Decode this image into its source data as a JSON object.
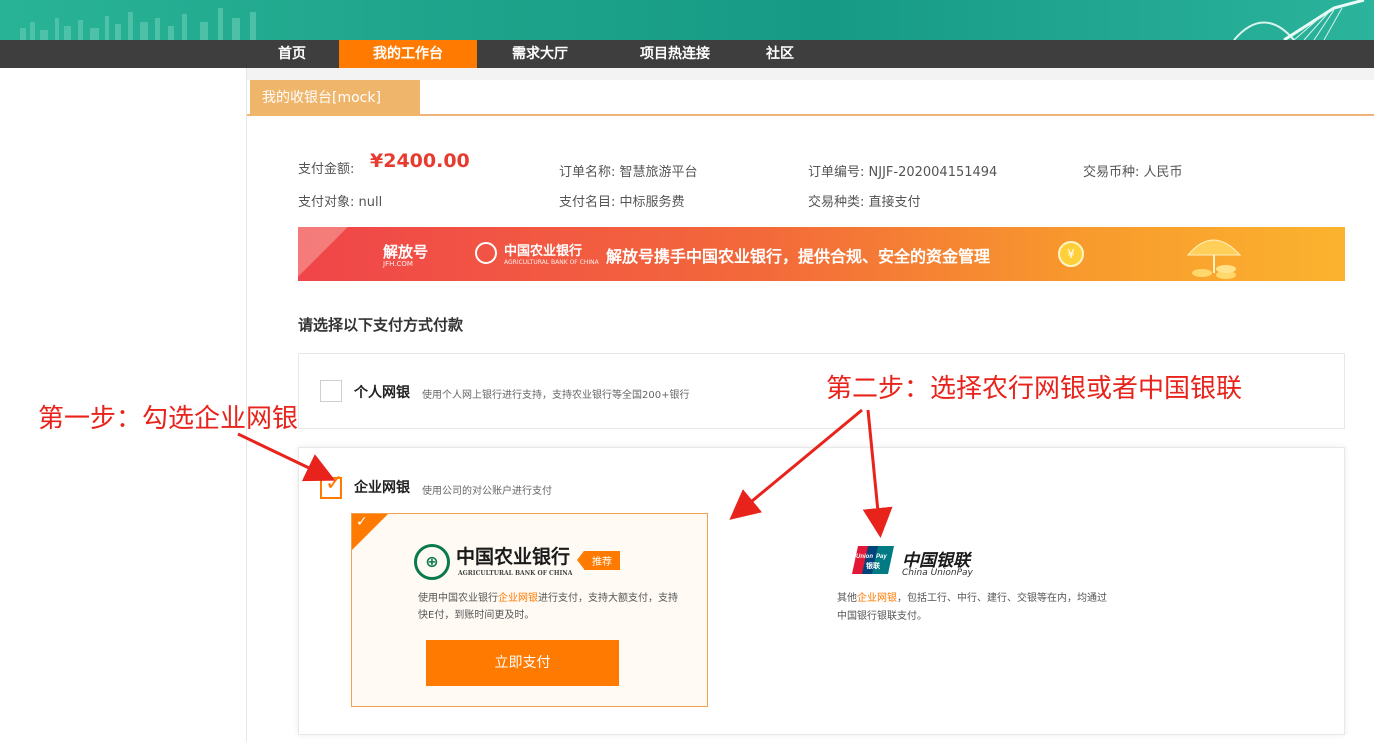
{
  "nav": {
    "items": [
      "首页",
      "我的工作台",
      "需求大厅",
      "项目热连接",
      "社区"
    ],
    "active_index": 1
  },
  "tab": {
    "label": "我的收银台[mock]"
  },
  "order": {
    "amount_label": "支付金额:",
    "amount_value": "¥2400.00",
    "order_name": "订单名称: 智慧旅游平台",
    "order_no": "订单编号: NJJF-202004151494",
    "currency": "交易币种: 人民币",
    "pay_target": "支付对象: null",
    "pay_item": "支付名目: 中标服务费",
    "trade_type": "交易种类: 直接支付"
  },
  "promo": {
    "logo1": "解放号",
    "logo1_sub": "JFH.COM",
    "logo2": "中国农业银行",
    "logo2_sub": "AGRICULTURAL BANK OF CHINA",
    "text": "解放号携手中国农业银行，提供合规、安全的资金管理",
    "coin_icon": "yuan-coin-icon"
  },
  "section_title": "请选择以下支付方式付款",
  "personal": {
    "title": "个人网银",
    "desc": "使用个人网上银行进行支持，支持农业银行等全国200+银行",
    "checked": false
  },
  "corporate": {
    "title": "企业网银",
    "desc": "使用公司的对公账户进行支付",
    "checked": true
  },
  "abc_card": {
    "logo_icon": "abc-bank-logo-icon",
    "name": "中国农业银行",
    "name_en": "AGRICULTURAL BANK OF CHINA",
    "badge": "推荐",
    "desc_pre": "使用中国农业银行",
    "desc_highlight": "企业网银",
    "desc_post": "进行支付，支持大额支付，支持快E付，到账时间更及时。",
    "button": "立即支付",
    "selected": true
  },
  "unionpay": {
    "logo_icon": "unionpay-logo-icon",
    "logo_text": "UnionPay 银联",
    "name": "中国银联",
    "name_en": "China UnionPay",
    "desc_pre": "其他",
    "desc_highlight": "企业网银",
    "desc_post": "，包括工行、中行、建行、交银等在内，均通过中国银行银联支付。"
  },
  "annotations": {
    "step1": "第一步：勾选企业网银",
    "step2": "第二步：选择农行网银或者中国银联",
    "color": "#e8231c"
  },
  "colors": {
    "accent": "#ff7a00",
    "nav_bg": "#3e3e3e",
    "banner": "#1fa58c",
    "amount": "#e63b2e"
  }
}
